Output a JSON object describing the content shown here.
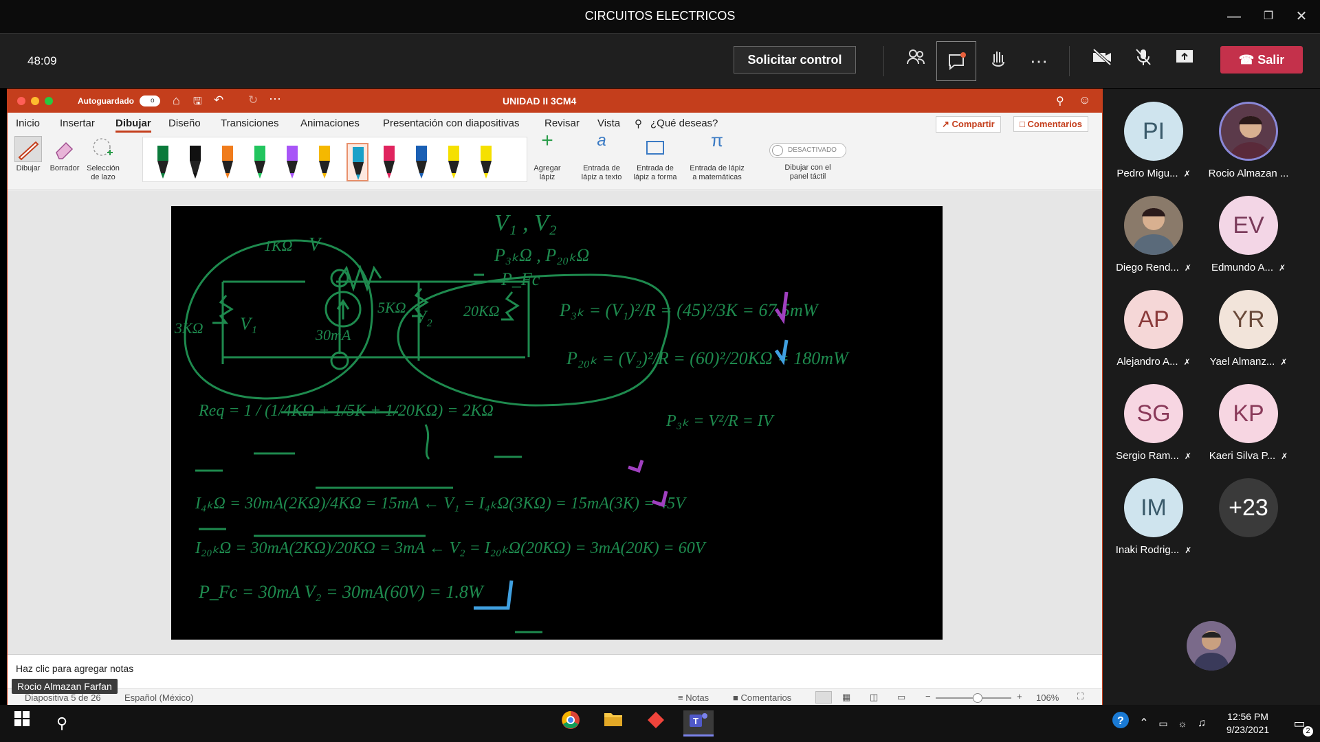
{
  "meeting": {
    "title": "CIRCUITOS ELECTRICOS",
    "timer": "48:09",
    "request_control": "Solicitar control",
    "leave": "Salir"
  },
  "ppt": {
    "autosave": "Autoguardado",
    "autosave_state": "o",
    "doc_title": "UNIDAD II 3CM4",
    "tabs": [
      "Inicio",
      "Insertar",
      "Dibujar",
      "Diseño",
      "Transiciones",
      "Animaciones",
      "Presentación con diapositivas",
      "Revisar",
      "Vista"
    ],
    "active_tab": "Dibujar",
    "tell_me": "¿Qué deseas?",
    "share": "Compartir",
    "comments": "Comentarios",
    "tools": {
      "draw": "Dibujar",
      "eraser": "Borrador",
      "lasso1": "Selección",
      "lasso2": "de lazo",
      "add_pen1": "Agregar",
      "add_pen2": "lápiz",
      "ink_text1": "Entrada de",
      "ink_text2": "lápiz a texto",
      "ink_shape1": "Entrada de",
      "ink_shape2": "lápiz a forma",
      "ink_math1": "Entrada de lápiz",
      "ink_math2": "a matemáticas",
      "toggle": "DESACTIVADO",
      "touch1": "Dibujar con el",
      "touch2": "panel táctil"
    },
    "pen_colors": [
      "#0b7a3b",
      "#111111",
      "#f07c1c",
      "#22c55e",
      "#a855f7",
      "#f5b800",
      "#1aa0c8",
      "#e0245e",
      "#1a5fb4",
      "#f5e000",
      "#f5e000"
    ],
    "notes_placeholder": "Haz clic para agregar notas",
    "status": {
      "slide": "Diapositiva 5 de 26",
      "language": "Español (México)",
      "notes": "Notas",
      "comments": "Comentarios",
      "zoom": "106%"
    },
    "zoom_fraction": 0.55
  },
  "presenter_tag": "Rocio Almazan Farfan",
  "participants": [
    {
      "initials": "PI",
      "name": "Pedro Migu...",
      "bg": "#cfe4ee",
      "fg": "#3a5a6a",
      "muted": true
    },
    {
      "initials": "",
      "name": "Rocio Almazan ...",
      "bg": "#5b3a4a",
      "fg": "#fff",
      "muted": false,
      "photo": true
    },
    {
      "initials": "",
      "name": "Diego Rend...",
      "bg": "#8a7a6a",
      "fg": "#fff",
      "muted": true,
      "photo": true
    },
    {
      "initials": "EV",
      "name": "Edmundo A...",
      "bg": "#f3d6e6",
      "fg": "#7a3a5a",
      "muted": true
    },
    {
      "initials": "AP",
      "name": "Alejandro A...",
      "bg": "#f5d7d7",
      "fg": "#8a3b3b",
      "muted": true
    },
    {
      "initials": "YR",
      "name": "Yael Almanz...",
      "bg": "#f2e4da",
      "fg": "#6a4a3a",
      "muted": true
    },
    {
      "initials": "SG",
      "name": "Sergio Ram...",
      "bg": "#f7d6e2",
      "fg": "#8a3a5a",
      "muted": true
    },
    {
      "initials": "KP",
      "name": "Kaeri Silva P...",
      "bg": "#f7d6e2",
      "fg": "#8a3a5a",
      "muted": true
    },
    {
      "initials": "IM",
      "name": "Inaki Rodrig...",
      "bg": "#cfe4ee",
      "fg": "#3a5a6a",
      "muted": true
    },
    {
      "initials": "+23",
      "name": "",
      "bg": "#3a3a3a",
      "fg": "#fff",
      "muted": false
    }
  ],
  "board": {
    "top1": "V₁ , V₂",
    "top2": "P₃ₖΩ , P₂₀ₖΩ",
    "top3": "P_Fc",
    "r1k": "1KΩ",
    "r3k": "3KΩ",
    "r5k": "5KΩ",
    "r20k": "20KΩ",
    "src": "30mA",
    "v1": "V₁",
    "v2": "V₂",
    "vtop": "V",
    "eq1": "P₃ₖ = (V₁)²/R = (45)²/3K = 67.5mW",
    "eq2": "P₂₀ₖ = (V₂)²/R = (60)²/20KΩ = 180mW",
    "req": "Req = 1 / (1/4KΩ + 1/5K + 1/20KΩ) = 2KΩ",
    "i4k": "I₄ₖΩ = 30mA(2KΩ)/4KΩ = 15mA  ←  V₁ = I₄ₖΩ(3KΩ) = 15mA(3K) = 45V",
    "p3k": "P₃ₖ = V²/R = IV",
    "i20k": "I₂₀ₖΩ = 30mA(2KΩ)/20KΩ = 3mA  ←  V₂ = I₂₀ₖΩ(20KΩ) = 3mA(20K) = 60V",
    "pfc": "P_Fc = 30mA V₂ = 30mA(60V) = 1.8W"
  },
  "taskbar": {
    "time": "12:56 PM",
    "date": "9/23/2021",
    "notif": "2"
  }
}
